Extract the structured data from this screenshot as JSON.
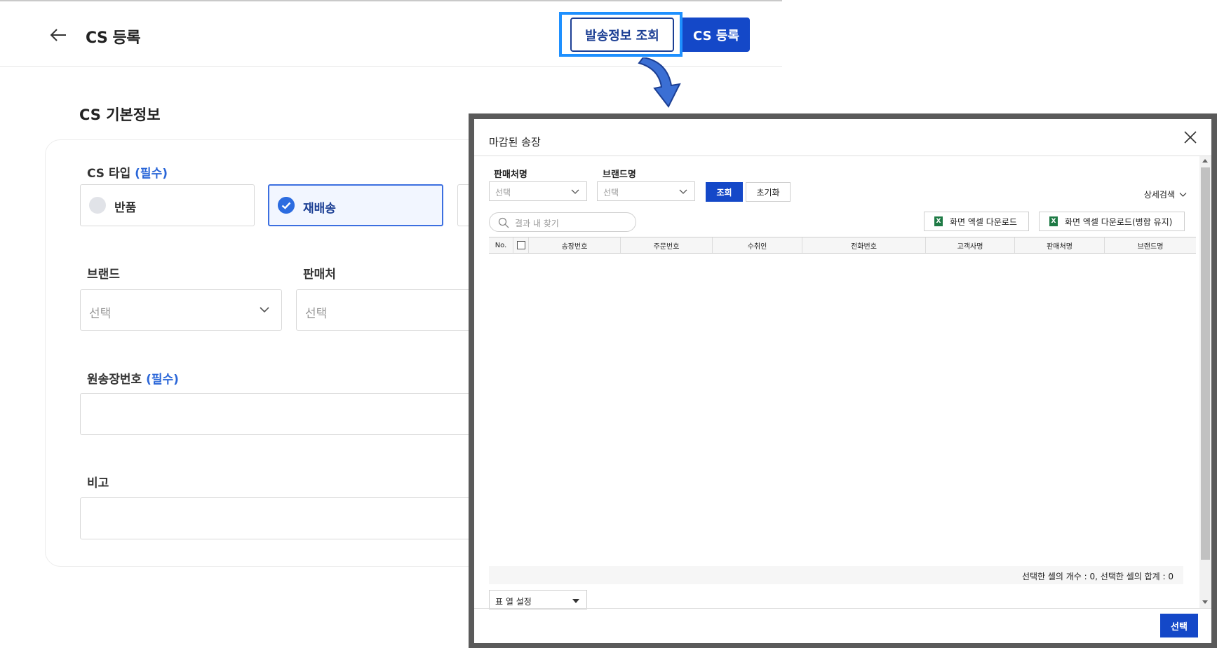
{
  "header": {
    "title": "CS 등록",
    "ship_info_button": "발송정보 조회",
    "register_button": "CS 등록"
  },
  "form": {
    "section_title": "CS 기본정보",
    "cs_type": {
      "label": "CS 타입",
      "required": "(필수)",
      "options": [
        "반품",
        "재배송"
      ],
      "selected": "재배송"
    },
    "brand": {
      "label": "브랜드",
      "placeholder": "선택"
    },
    "seller": {
      "label": "판매처",
      "placeholder": "선택"
    },
    "original_invoice": {
      "label": "원송장번호",
      "required": "(필수)"
    },
    "note": {
      "label": "비고"
    }
  },
  "modal": {
    "title": "마감된 송장",
    "filters": {
      "seller_label": "판매처명",
      "seller_placeholder": "선택",
      "brand_label": "브랜드명",
      "brand_placeholder": "선택",
      "search_button": "조회",
      "reset_button": "초기화",
      "advanced_search": "상세검색"
    },
    "find_placeholder": "결과 내 찾기",
    "excel_download": "화면 엑셀 다운로드",
    "excel_download_merged": "화면 엑셀 다운로드(병합 유지)",
    "columns": [
      "No.",
      "",
      "송장번호",
      "주문번호",
      "수취인",
      "전화번호",
      "고객사명",
      "판매처명",
      "브랜드명"
    ],
    "status": "선택한 셀의 개수 : 0, 선택한 셀의 합계 : 0",
    "column_settings": "표 열 설정",
    "select_button": "선택"
  },
  "colors": {
    "primary": "#1448c8",
    "highlight": "#1e90ff",
    "required": "#2a66d8",
    "excel": "#1e7a45"
  }
}
